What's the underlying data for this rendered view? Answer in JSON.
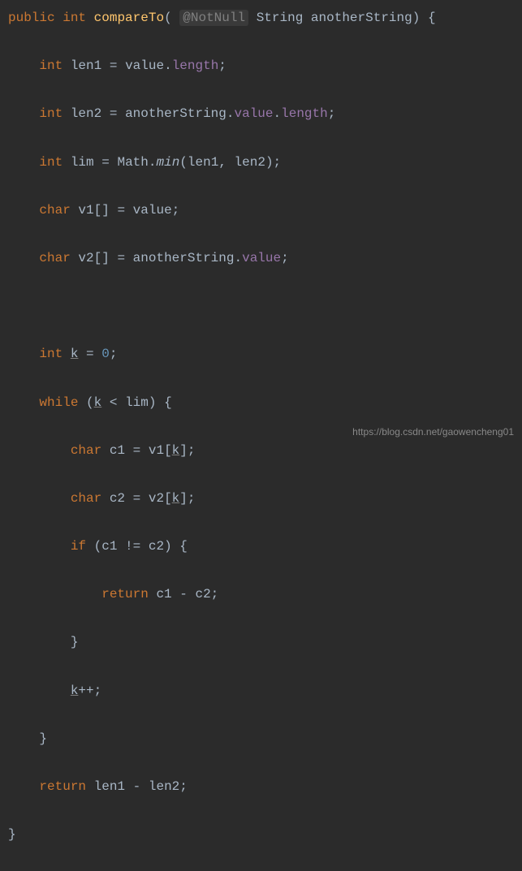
{
  "code": {
    "l1": {
      "kw_public": "public",
      "kw_int": "int",
      "method": "compareTo",
      "annotation": "@NotNull",
      "type_string": "String",
      "param": "anotherString",
      "brace": "{"
    },
    "l2": {
      "kw_int": "int",
      "var": "len1",
      "eq": "=",
      "val": "value",
      "dot": ".",
      "field": "length",
      "semi": ";"
    },
    "l3": {
      "kw_int": "int",
      "var": "len2",
      "eq": "=",
      "val": "anotherString",
      "dot1": ".",
      "field1": "value",
      "dot2": ".",
      "field2": "length",
      "semi": ";"
    },
    "l4": {
      "kw_int": "int",
      "var": "lim",
      "eq": "=",
      "cls": "Math",
      "dot": ".",
      "method": "min",
      "lp": "(",
      "a1": "len1",
      "comma": ",",
      "a2": "len2",
      "rp": ")",
      "semi": ";"
    },
    "l5": {
      "kw_char": "char",
      "var": "v1",
      "brackets": "[]",
      "eq": "=",
      "val": "value",
      "semi": ";"
    },
    "l6": {
      "kw_char": "char",
      "var": "v2",
      "brackets": "[]",
      "eq": "=",
      "val": "anotherString",
      "dot": ".",
      "field": "value",
      "semi": ";"
    },
    "l8": {
      "kw_int": "int",
      "var": "k",
      "eq": "=",
      "num": "0",
      "semi": ";"
    },
    "l9": {
      "kw_while": "while",
      "lp": "(",
      "var": "k",
      "op": "<",
      "var2": "lim",
      "rp": ")",
      "brace": "{"
    },
    "l10": {
      "kw_char": "char",
      "var": "c1",
      "eq": "=",
      "arr": "v1",
      "lb": "[",
      "idx": "k",
      "rb": "]",
      "semi": ";"
    },
    "l11": {
      "kw_char": "char",
      "var": "c2",
      "eq": "=",
      "arr": "v2",
      "lb": "[",
      "idx": "k",
      "rb": "]",
      "semi": ";"
    },
    "l12": {
      "kw_if": "if",
      "lp": "(",
      "a1": "c1",
      "op": "!=",
      "a2": "c2",
      "rp": ")",
      "brace": "{"
    },
    "l13": {
      "kw_return": "return",
      "a1": "c1",
      "op": "-",
      "a2": "c2",
      "semi": ";"
    },
    "l14": {
      "brace": "}"
    },
    "l15": {
      "var": "k",
      "op": "++",
      "semi": ";"
    },
    "l16": {
      "brace": "}"
    },
    "l17": {
      "kw_return": "return",
      "a1": "len1",
      "op": "-",
      "a2": "len2",
      "semi": ";"
    },
    "l18": {
      "brace": "}"
    }
  },
  "watermark": "https://blog.csdn.net/gaowencheng01"
}
